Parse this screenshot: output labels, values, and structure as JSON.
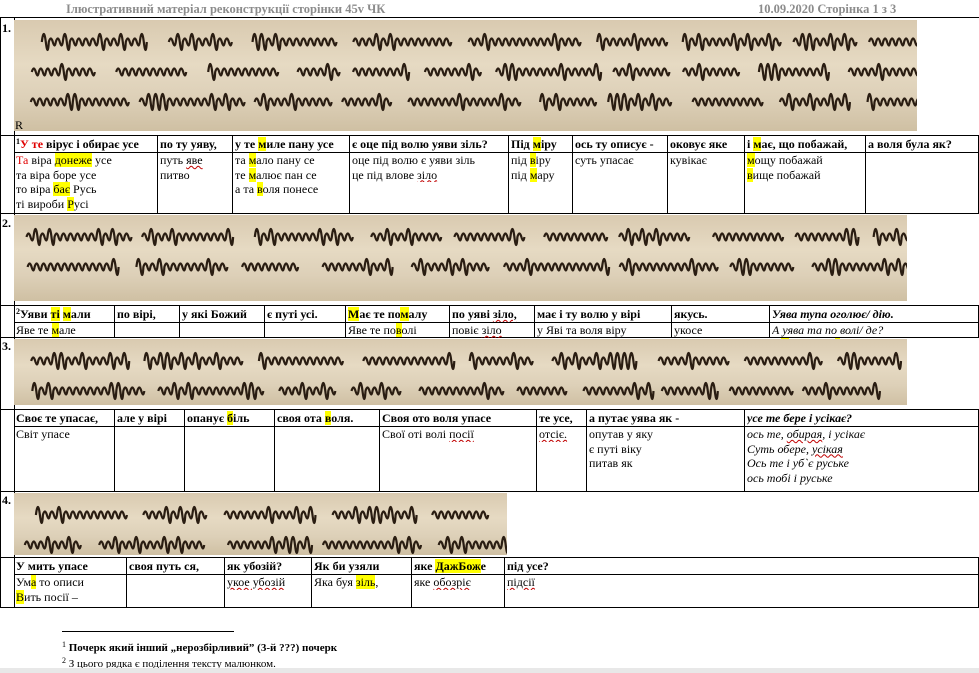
{
  "header": {
    "title": "Ілюстративний матеріал  реконструкції сторінки 45v ЧК",
    "date_page": "10.09.2020  Сторінка 1 з 3"
  },
  "sections": [
    {
      "number": "1.",
      "line_marker": "R",
      "footnote_mark": "1",
      "headers": [
        {
          "parts": [
            {
              "t": "У те",
              "c": "red"
            },
            {
              "t": " вірус і обирає усе"
            }
          ]
        },
        {
          "parts": [
            {
              "t": "по ту уяву,"
            }
          ]
        },
        {
          "parts": [
            {
              "t": "у те "
            },
            {
              "t": "м",
              "c": "y"
            },
            {
              "t": "иле пану усе"
            }
          ]
        },
        {
          "parts": [
            {
              "t": "є оце під волю уяви зіль?"
            }
          ]
        },
        {
          "parts": [
            {
              "t": "Під "
            },
            {
              "t": "м",
              "c": "y"
            },
            {
              "t": "іру"
            }
          ]
        },
        {
          "parts": [
            {
              "t": "ось ту описує -"
            }
          ]
        },
        {
          "parts": [
            {
              "t": "оковує яке"
            }
          ]
        },
        {
          "parts": [
            {
              "t": "і "
            },
            {
              "t": "м",
              "c": "y"
            },
            {
              "t": "ає, що побажай,"
            }
          ]
        },
        {
          "parts": [
            {
              "t": "а воля була як?"
            }
          ]
        }
      ],
      "cells": [
        [
          [
            {
              "t": "Та",
              "c": "red"
            },
            {
              "t": " віра "
            },
            {
              "t": "донеже",
              "c": "y"
            },
            {
              "t": " усе"
            }
          ],
          [
            {
              "t": "та віра боре усе"
            }
          ],
          [
            {
              "t": "то віра "
            },
            {
              "t": "бає",
              "c": "y"
            },
            {
              "t": " Русь"
            }
          ],
          [
            {
              "t": "ті вироби "
            },
            {
              "t": "Р",
              "c": "y"
            },
            {
              "t": "усі"
            }
          ]
        ],
        [
          [
            {
              "t": "путь "
            },
            {
              "t": "яве",
              "c": "sq"
            }
          ],
          [
            {
              "t": "питво"
            }
          ]
        ],
        [
          [
            {
              "t": "та "
            },
            {
              "t": "м",
              "c": "y"
            },
            {
              "t": "ало пану се"
            }
          ],
          [
            {
              "t": "те "
            },
            {
              "t": "м",
              "c": "y"
            },
            {
              "t": "алює пан се"
            }
          ],
          [
            {
              "t": "а та "
            },
            {
              "t": "в",
              "c": "y"
            },
            {
              "t": "оля понесе"
            }
          ]
        ],
        [
          [
            {
              "t": "оце під волю є уяви зіль"
            }
          ],
          [
            {
              "t": "це під влове "
            },
            {
              "t": "зіло",
              "c": "sq"
            }
          ]
        ],
        [
          [
            {
              "t": "під "
            },
            {
              "t": "в",
              "c": "y"
            },
            {
              "t": "іру"
            }
          ],
          [
            {
              "t": "під "
            },
            {
              "t": "м",
              "c": "y"
            },
            {
              "t": "ару"
            }
          ]
        ],
        [
          [
            {
              "t": "суть упасає"
            }
          ]
        ],
        [
          [
            {
              "t": "кувікає"
            }
          ]
        ],
        [
          [
            {
              "t": "м",
              "c": "y"
            },
            {
              "t": "ощу побажай"
            }
          ],
          [
            {
              "t": "в",
              "c": "y"
            },
            {
              "t": "ище побажай"
            }
          ]
        ],
        []
      ]
    },
    {
      "number": "2.",
      "footnote_mark": "2",
      "headers": [
        {
          "parts": [
            {
              "t": "Уяви "
            },
            {
              "t": "ті",
              "c": "y"
            },
            {
              "t": " "
            },
            {
              "t": "м",
              "c": "y"
            },
            {
              "t": "али"
            }
          ]
        },
        {
          "parts": [
            {
              "t": "по вірі,"
            }
          ]
        },
        {
          "parts": [
            {
              "t": "у які Божий"
            }
          ]
        },
        {
          "parts": [
            {
              "t": "є путі усі."
            }
          ]
        },
        {
          "parts": [
            {
              "t": "М",
              "c": "y"
            },
            {
              "t": "ає те по"
            },
            {
              "t": "м",
              "c": "y"
            },
            {
              "t": "алу"
            }
          ]
        },
        {
          "parts": [
            {
              "t": "по уяві "
            },
            {
              "t": "зіло,",
              "c": "sq"
            }
          ]
        },
        {
          "parts": [
            {
              "t": "має і ту волю у вірі"
            }
          ]
        },
        {
          "parts": [
            {
              "t": "якусь."
            }
          ]
        },
        {
          "parts": [
            {
              "t": "Уява тупа оголює/ дію.",
              "c": "it"
            }
          ]
        }
      ],
      "cells": [
        [
          [
            {
              "t": "Яве те "
            },
            {
              "t": "м",
              "c": "y"
            },
            {
              "t": "але"
            }
          ]
        ],
        [],
        [],
        [],
        [
          [
            {
              "t": "Яве те по"
            },
            {
              "t": "в",
              "c": "y"
            },
            {
              "t": "олі"
            }
          ]
        ],
        [
          [
            {
              "t": "повіє "
            },
            {
              "t": "зіло",
              "c": "sq"
            }
          ]
        ],
        [
          [
            {
              "t": "у Яві та воля віру"
            }
          ]
        ],
        [
          [
            {
              "t": "укосе"
            }
          ]
        ],
        [
          [
            {
              "t": "А уява та по волі/ де?",
              "c": "it"
            }
          ],
          [
            {
              "t": "а ",
              "c": "it"
            },
            {
              "t": "м",
              "c": "it y"
            },
            {
              "t": "ає те по ",
              "c": "it"
            },
            {
              "t": "г",
              "c": "it y"
            },
            {
              "t": "олу/ дію",
              "c": "it"
            }
          ]
        ]
      ]
    },
    {
      "number": "3.",
      "headers": [
        {
          "parts": [
            {
              "t": "Своє те упасає,"
            }
          ]
        },
        {
          "parts": [
            {
              "t": "але у вірі"
            }
          ]
        },
        {
          "parts": [
            {
              "t": "опанує "
            },
            {
              "t": "б",
              "c": "y"
            },
            {
              "t": "іль"
            }
          ]
        },
        {
          "parts": [
            {
              "t": "своя ота "
            },
            {
              "t": "в",
              "c": "y"
            },
            {
              "t": "оля."
            }
          ]
        },
        {
          "parts": [
            {
              "t": "Своя ото воля упасе"
            }
          ]
        },
        {
          "parts": [
            {
              "t": "те усе,"
            }
          ]
        },
        {
          "parts": [
            {
              "t": "а путає уява як -"
            }
          ]
        },
        {
          "parts": [
            {
              "t": " усе те бере і усікає?",
              "c": "it"
            }
          ]
        }
      ],
      "cells": [
        [
          [
            {
              "t": "Світ упасе"
            }
          ]
        ],
        [],
        [],
        [],
        [
          [
            {
              "t": "Свої оті волі "
            },
            {
              "t": "посії",
              "c": "sq"
            }
          ]
        ],
        [
          [
            {
              "t": "отсіє.",
              "c": "sq"
            }
          ]
        ],
        [
          [
            {
              "t": "опутав у яку"
            }
          ],
          [
            {
              "t": "є путі віку"
            }
          ],
          [
            {
              "t": "питав як"
            }
          ]
        ],
        [
          [
            {
              "t": "ось те, ",
              "c": "it"
            },
            {
              "t": "обирая",
              "c": "it sq"
            },
            {
              "t": ", і усікає",
              "c": "it"
            }
          ],
          [
            {
              "t": "Суть обере, ",
              "c": "it"
            },
            {
              "t": "усікая",
              "c": "it sq"
            }
          ],
          [
            {
              "t": "Ось те і  уб`є руське",
              "c": "it"
            }
          ],
          [
            {
              "t": "ось тобі і руське",
              "c": "it"
            }
          ]
        ]
      ]
    },
    {
      "number": "4.",
      "headers": [
        {
          "parts": [
            {
              "t": "У мить упасе"
            }
          ]
        },
        {
          "parts": [
            {
              "t": "своя путь ся,"
            }
          ]
        },
        {
          "parts": [
            {
              "t": "як убозій?"
            }
          ]
        },
        {
          "parts": [
            {
              "t": "Як би узяли"
            }
          ]
        },
        {
          "parts": [
            {
              "t": "яке "
            },
            {
              "t": "ДажБож",
              "c": "y"
            },
            {
              "t": "е"
            }
          ]
        },
        {
          "parts": [
            {
              "t": "під усе?"
            }
          ]
        }
      ],
      "cells": [
        [
          [
            {
              "t": "Ум"
            },
            {
              "t": "а",
              "c": "y"
            },
            {
              "t": " то описи"
            }
          ],
          [
            {
              "t": "В",
              "c": "y"
            },
            {
              "t": "ить посії –"
            }
          ]
        ],
        [],
        [
          [
            {
              "t": "укое убозій",
              "c": "sq"
            }
          ]
        ],
        [
          [
            {
              "t": "Яка буя "
            },
            {
              "t": "зіль",
              "c": "y"
            },
            {
              "t": ","
            }
          ]
        ],
        [
          [
            {
              "t": "яке "
            },
            {
              "t": "обозріє",
              "c": "sq"
            }
          ]
        ],
        [
          [
            {
              "t": "підсії",
              "c": "sq"
            }
          ]
        ]
      ]
    }
  ],
  "footnotes": [
    {
      "mark": "1",
      "text": " Почерк який інший „нерозбірливий” (3-й ???) почерк",
      "bold": true
    },
    {
      "mark": "2",
      "text": " З цього рядка є поділення тексту малюнком.",
      "bold": false
    }
  ]
}
